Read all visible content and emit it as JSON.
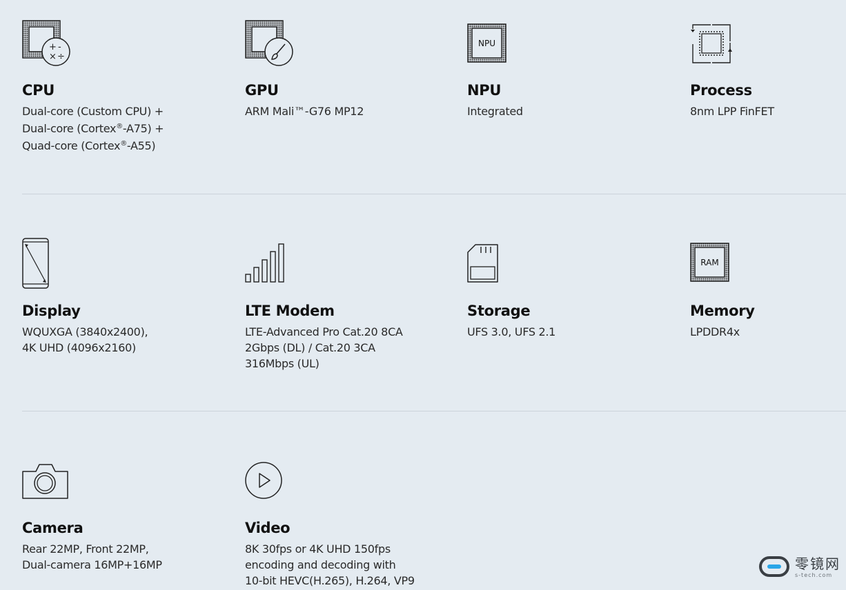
{
  "specs": {
    "cpu": {
      "icon": "cpu-icon",
      "title": "CPU",
      "lines": [
        "Dual-core (Custom CPU) +",
        "Dual-core (Cortex",
        "-A75) +",
        "Quad-core (Cortex",
        "-A55)"
      ],
      "reg": "®",
      "symbols": [
        "+",
        "-",
        "×",
        "÷"
      ]
    },
    "gpu": {
      "icon": "gpu-icon",
      "title": "GPU",
      "lines": [
        "ARM Mali™-G76 MP12"
      ]
    },
    "npu": {
      "icon": "npu-chip-icon",
      "title": "NPU",
      "chip_label": "NPU",
      "lines": [
        "Integrated"
      ]
    },
    "process": {
      "icon": "process-chip-icon",
      "title": "Process",
      "lines": [
        "8nm LPP FinFET"
      ]
    },
    "display": {
      "icon": "phone-display-icon",
      "title": "Display",
      "lines": [
        "WQUXGA (3840x2400),",
        "4K UHD (4096x2160)"
      ]
    },
    "modem": {
      "icon": "signal-bars-icon",
      "title": "LTE Modem",
      "lines": [
        "LTE-Advanced Pro Cat.20 8CA",
        "2Gbps (DL) / Cat.20 3CA",
        "316Mbps (UL)"
      ]
    },
    "storage": {
      "icon": "sd-card-icon",
      "title": "Storage",
      "lines": [
        "UFS 3.0, UFS 2.1"
      ]
    },
    "memory": {
      "icon": "ram-chip-icon",
      "title": "Memory",
      "chip_label": "RAM",
      "lines": [
        "LPDDR4x"
      ]
    },
    "camera": {
      "icon": "camera-icon",
      "title": "Camera",
      "lines": [
        "Rear 22MP, Front 22MP,",
        "Dual-camera 16MP+16MP"
      ]
    },
    "video": {
      "icon": "play-circle-icon",
      "title": "Video",
      "lines": [
        "8K 30fps or 4K UHD 150fps",
        "encoding and decoding with",
        "10-bit HEVC(H.265), H.264, VP9"
      ]
    }
  },
  "watermark": {
    "text": "零镜网",
    "sub": "s-tech.com",
    "icon": "zero-lens-logo-icon"
  }
}
